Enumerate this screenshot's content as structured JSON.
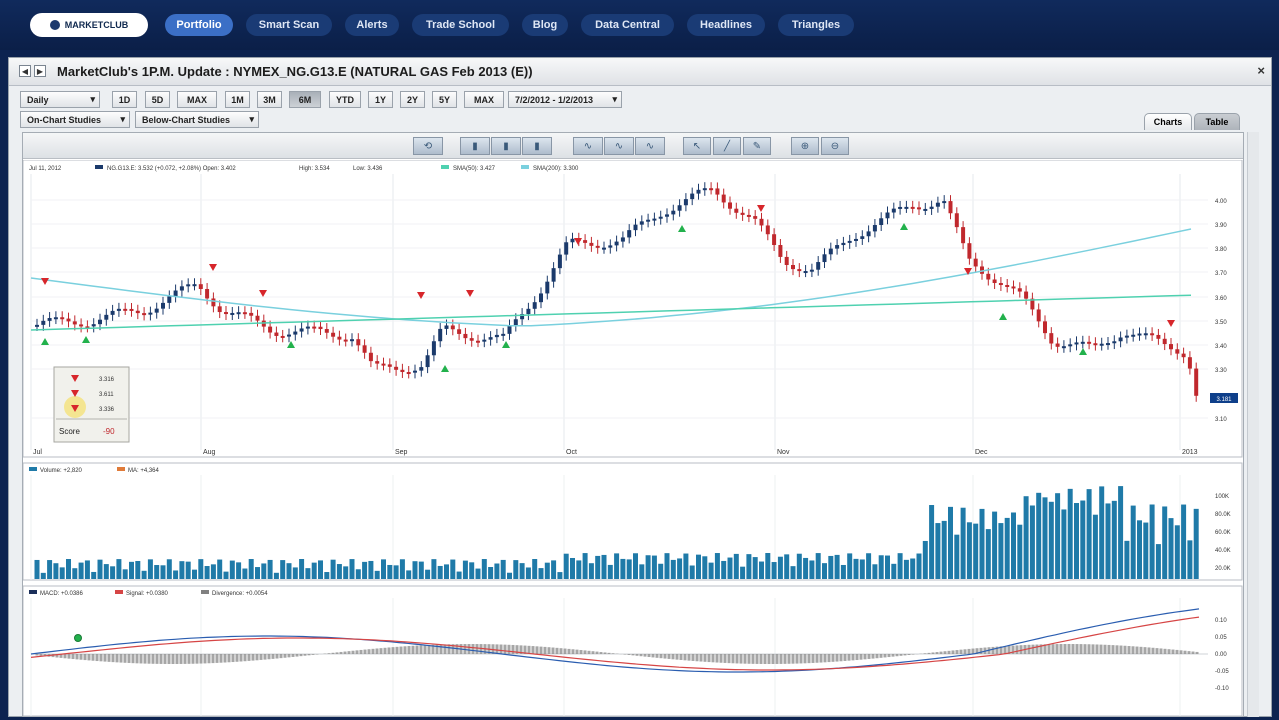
{
  "nav": {
    "logo": "MARKETCLUB",
    "items": [
      "Portfolio",
      "Smart Scan",
      "Alerts",
      "Trade School",
      "Blog",
      "Data Central",
      "Headlines",
      "Triangles"
    ]
  },
  "window": {
    "title": "MarketClub's 1P.M. Update  : NYMEX_NG.G13.E (NATURAL GAS Feb 2013 (E))",
    "close": "×"
  },
  "toolbar": {
    "interval": "Daily",
    "ranges": [
      "1D",
      "5D",
      "MAX",
      "1M",
      "3M",
      "6M",
      "YTD",
      "1Y",
      "2Y",
      "5Y",
      "MAX"
    ],
    "date_range": "7/2/2012 - 1/2/2013",
    "on_chart": "On-Chart Studies",
    "below_chart": "Below-Chart Studies"
  },
  "tabs": {
    "charts": "Charts",
    "table": "Table"
  },
  "price_panel": {
    "date": "Jul 11, 2012",
    "symbol_info": "NG.G13.E: 3.532 (+0.072, +2.08%)  Open: 3.402",
    "high": "High: 3.534",
    "low": "Low: 3.436",
    "sma50": "SMA(50): 3.427",
    "sma200": "SMA(200): 3.300",
    "y_ticks": [
      "4.00",
      "3.90",
      "3.80",
      "3.70",
      "3.60",
      "3.50",
      "3.40",
      "3.30",
      "3.10"
    ],
    "months": [
      "Jul",
      "Aug",
      "Sep",
      "Oct",
      "Nov",
      "Dec",
      "2013"
    ],
    "last_price": "3.181",
    "score_box": {
      "rows": [
        "3.316",
        "3.611",
        "3.336"
      ],
      "score_label": "Score",
      "score_value": "-90"
    }
  },
  "volume_panel": {
    "legend_volume": "Volume: +2,820",
    "legend_ma": "MA: +4,364",
    "y_ticks": [
      "100K",
      "80.0K",
      "60.0K",
      "40.0K",
      "20.0K"
    ]
  },
  "macd_panel": {
    "legend_macd": "MACD: +0.0386",
    "legend_signal": "Signal: +0.0380",
    "legend_divergence": "Divergence: +0.0054",
    "y_ticks": [
      "0.10",
      "0.05",
      "0.00",
      "-0.05",
      "-0.10"
    ]
  },
  "colors": {
    "nav_bg": "#0b1f48",
    "up_candle": "#1b3a6b",
    "down_candle": "#c0282d",
    "sma50": "#4fd1b0",
    "sma200": "#7ad0de",
    "volume": "#1f7aa8",
    "macd": "#2a5db0",
    "signal": "#d64545",
    "divergence": "#808080"
  }
}
